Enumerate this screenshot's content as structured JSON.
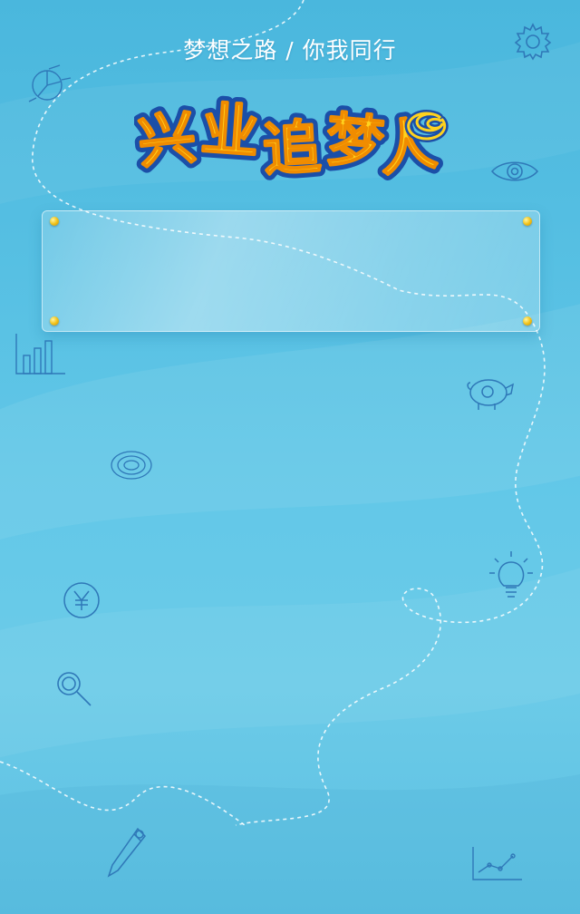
{
  "header": {
    "subtitle": "梦想之路 / 你我同行"
  },
  "logo": {
    "title": "兴业追梦人"
  },
  "colors": {
    "background": "#57c0e3",
    "logo_fill": "#ffd21e",
    "logo_outline": "#1b4fa8",
    "doodle_line": "#2f78b8",
    "pin": "#f2c21a"
  },
  "doodles": [
    "pie-chart-icon",
    "settings-gear-icon",
    "eye-icon",
    "bar-chart-icon",
    "piggy-bank-icon",
    "spiral-icon",
    "lightbulb-icon",
    "yen-coin-icon",
    "magnifier-icon",
    "pencil-icon",
    "line-chart-icon"
  ]
}
